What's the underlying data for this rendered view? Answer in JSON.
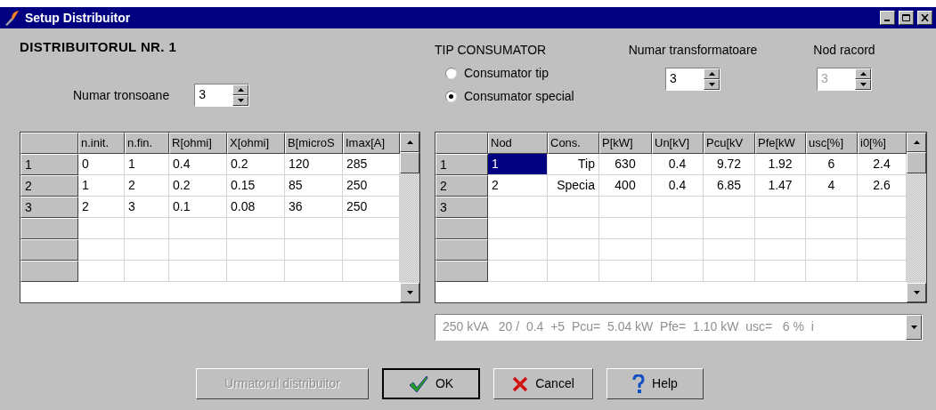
{
  "window": {
    "title": "Setup Distribuitor"
  },
  "left": {
    "heading": "DISTRIBUITORUL NR. 1",
    "spinner": {
      "label": "Numar tronsoane",
      "value": "3",
      "disabled": false
    },
    "table": {
      "columns": [
        "n.init.",
        "n.fin.",
        "R[ohmi]",
        "X[ohmi]",
        "B[microS",
        "Imax[A]"
      ],
      "rows": [
        {
          "header": "1",
          "cells": [
            "0",
            "1",
            "0.4",
            "0.2",
            "120",
            "285"
          ]
        },
        {
          "header": "2",
          "cells": [
            "1",
            "2",
            "0.2",
            "0.15",
            "85",
            "250"
          ]
        },
        {
          "header": "3",
          "cells": [
            "2",
            "3",
            "0.1",
            "0.08",
            "36",
            "250"
          ]
        }
      ]
    }
  },
  "right": {
    "heading": "TIP CONSUMATOR",
    "radios": [
      {
        "label": "Consumator tip",
        "selected": false
      },
      {
        "label": "Consumator special",
        "selected": true
      }
    ],
    "spinners": [
      {
        "label": "Numar transformatoare",
        "value": "3",
        "disabled": false
      },
      {
        "label": "Nod racord",
        "value": "3",
        "disabled": true
      }
    ],
    "table": {
      "columns": [
        "Nod",
        "Cons.",
        "P[kW]",
        "Un[kV]",
        "Pcu[kV",
        "Pfe[kW",
        "usc[%]",
        "i0[%]"
      ],
      "rows": [
        {
          "header": "1",
          "cells": [
            {
              "text": "1",
              "selected": true
            },
            {
              "text": "Tip",
              "selected": false
            },
            {
              "text": "630",
              "selected": false
            },
            {
              "text": "0.4",
              "selected": false
            },
            {
              "text": "9.72",
              "selected": false
            },
            {
              "text": "1.92",
              "selected": false
            },
            {
              "text": "6",
              "selected": false
            },
            {
              "text": "2.4",
              "selected": false
            }
          ]
        },
        {
          "header": "2",
          "cells": [
            {
              "text": "2",
              "selected": false
            },
            {
              "text": "Specia",
              "selected": false
            },
            {
              "text": "400",
              "selected": false
            },
            {
              "text": "0.4",
              "selected": false
            },
            {
              "text": "6.85",
              "selected": false
            },
            {
              "text": "1.47",
              "selected": false
            },
            {
              "text": "4",
              "selected": false
            },
            {
              "text": "2.6",
              "selected": false
            }
          ]
        },
        {
          "header": "3",
          "cells": []
        }
      ]
    },
    "combo": {
      "value": "250 kVA   20 /  0.4  +5  Pcu=  5.04 kW  Pfe=  1.10 kW  usc=   6 %  i",
      "disabled": true
    }
  },
  "buttons": [
    {
      "kind": "plain",
      "label": "Urmatorul distribuitor",
      "disabled": true
    },
    {
      "kind": "ok",
      "label": "OK",
      "disabled": false
    },
    {
      "kind": "cancel",
      "label": "Cancel",
      "disabled": false
    },
    {
      "kind": "help",
      "label": "Help",
      "disabled": false
    }
  ]
}
